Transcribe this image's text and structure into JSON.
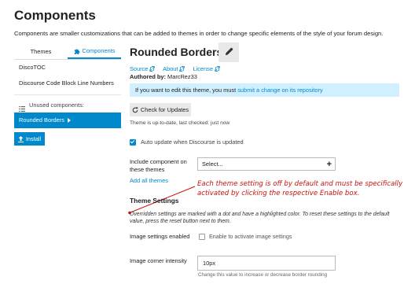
{
  "page": {
    "title": "Components",
    "description": "Components are smaller customizations that can be added to themes in order to change specific elements of the style of your forum design."
  },
  "sidebar": {
    "tabs": [
      {
        "label": "Themes",
        "active": false
      },
      {
        "label": "Components",
        "active": true,
        "icon": "puzzle-icon"
      }
    ],
    "items": [
      "DiscoTOC",
      "Discourse Code Block Line Numbers"
    ],
    "unused_label": "Unused components:",
    "selected_item": "Rounded Borders",
    "install_label": "Install"
  },
  "theme": {
    "title": "Rounded Borders",
    "links": [
      "Source",
      "About",
      "License"
    ],
    "authored_prefix": "Authored by:",
    "author": "MarcRez33",
    "notice_text": "If you want to edit this theme, you must",
    "notice_link": "submit a change on its repository",
    "check_updates_label": "Check for Updates",
    "up_to_date_text": "Theme is up-to-date, last checked: just now",
    "auto_update_label": "Auto update when Discourse is updated",
    "auto_update_checked": true,
    "include_label": "Include component on these themes",
    "include_placeholder": "Select...",
    "add_all_label": "Add all themes"
  },
  "annotation": {
    "text": "Each theme setting is off by default and must be specifically activated by clicking the respective Enable box."
  },
  "settings": {
    "heading": "Theme Settings",
    "note": "Overridden settings are marked with a dot and have a highlighted color. To reset these settings to the default value, press the reset button next to them.",
    "image_settings_label": "Image settings enabled",
    "image_settings_checkbox_label": "Enable to activate image settings",
    "image_settings_checked": false,
    "corner_label": "Image corner intensity",
    "corner_value": "10px",
    "corner_help": "Change this value to increase or decrease border rounding"
  },
  "colors": {
    "accent": "#0088cc",
    "notice_bg": "#d1f0ff",
    "annotation": "#cc1111"
  }
}
